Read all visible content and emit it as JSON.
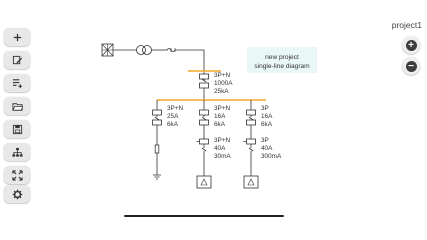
{
  "project": {
    "name": "project1"
  },
  "toolbar": {
    "buttons": [
      {
        "name": "add-button",
        "icon": "plus-icon"
      },
      {
        "name": "edit-button",
        "icon": "pencil-icon"
      },
      {
        "name": "add-list-button",
        "icon": "list-add-icon"
      },
      {
        "name": "open-button",
        "icon": "folder-icon"
      },
      {
        "name": "save-button",
        "icon": "floppy-disk-icon"
      },
      {
        "name": "hierarchy-button",
        "icon": "sitemap-icon"
      },
      {
        "name": "fit-screen-button",
        "icon": "expand-arrows-icon"
      },
      {
        "name": "settings-button",
        "icon": "gear-icon"
      }
    ]
  },
  "zoom": {
    "in_symbol": "+",
    "out_symbol": "−"
  },
  "diagram": {
    "note": {
      "line1": "new project",
      "line2": "single-line diagram"
    },
    "main_breaker": {
      "poles": "3P+N",
      "rating": "1000A",
      "breaking": "25kA"
    },
    "feeders": [
      {
        "poles": "3P+N",
        "rating": "25A",
        "breaking": "6kA"
      },
      {
        "poles": "3P+N",
        "rating": "16A",
        "breaking": "6kA",
        "rcd_poles": "3P+N",
        "rcd_rating": "40A",
        "rcd_sens": "30mA"
      },
      {
        "poles": "3P",
        "rating": "16A",
        "breaking": "6kA",
        "rcd_poles": "3P",
        "rcd_rating": "40A",
        "rcd_sens": "300mA"
      }
    ],
    "colors": {
      "busbar": "#f5a623",
      "line": "#444444",
      "icon": "#333333",
      "background": "#ffffff"
    }
  }
}
